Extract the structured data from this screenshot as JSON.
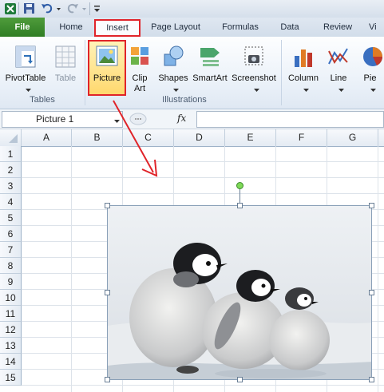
{
  "ribbon": {
    "tabs": [
      "File",
      "Home",
      "Insert",
      "Page Layout",
      "Formulas",
      "Data",
      "Review",
      "Vi"
    ],
    "active_tab": "Insert",
    "groups": {
      "tables": {
        "label": "Tables",
        "pivottable": "PivotTable",
        "table": "Table"
      },
      "illustrations": {
        "label": "Illustrations",
        "picture": "Picture",
        "clipart_line1": "Clip",
        "clipart_line2": "Art",
        "shapes": "Shapes",
        "smartart": "SmartArt",
        "screenshot": "Screenshot"
      },
      "charts": {
        "column": "Column",
        "line": "Line",
        "pie": "Pie"
      }
    }
  },
  "formula_bar": {
    "name_box": "Picture 1",
    "fx": "fx",
    "formula": ""
  },
  "grid": {
    "columns": [
      "A",
      "B",
      "C",
      "D",
      "E",
      "F",
      "G"
    ],
    "rows": [
      "1",
      "2",
      "3",
      "4",
      "5",
      "6",
      "7",
      "8",
      "9",
      "10",
      "11",
      "12",
      "13",
      "14",
      "15"
    ]
  },
  "colors": {
    "highlight": "#e0242a",
    "file_tab": "#3a8a2c",
    "selected_button": "#ffd86e"
  }
}
